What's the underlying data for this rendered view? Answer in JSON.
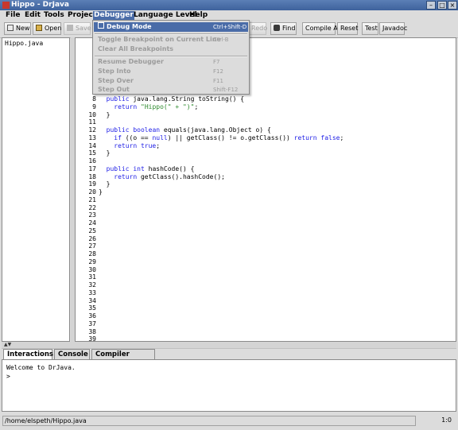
{
  "window": {
    "title": "Hippo - DrJava",
    "buttons": [
      "minimize-icon",
      "maximize-icon",
      "close-icon"
    ]
  },
  "menu": [
    {
      "label": "File"
    },
    {
      "label": "Edit"
    },
    {
      "label": "Tools"
    },
    {
      "label": "Project"
    },
    {
      "label": "Debugger"
    },
    {
      "label": "Language Level"
    },
    {
      "label": "Help"
    }
  ],
  "toolbar": {
    "new": "New",
    "open": "Open",
    "save": "Save",
    "redo": "Redo",
    "find": "Find",
    "compile_all": "Compile All",
    "reset": "Reset",
    "test": "Test",
    "javadoc": "Javadoc"
  },
  "files": [
    "Hippo.java"
  ],
  "editor": {
    "code_lines": [
      {
        "n": "8",
        "parts": [
          [
            "pl",
            "  "
          ],
          [
            "kw",
            "public"
          ],
          [
            "pl",
            " java.lang.String toString() {"
          ]
        ]
      },
      {
        "n": "9",
        "parts": [
          [
            "pl",
            "    "
          ],
          [
            "kw",
            "return"
          ],
          [
            "pl",
            " "
          ],
          [
            "str",
            "\"Hippo(\" + \")\""
          ],
          [
            "pl",
            ";"
          ]
        ]
      },
      {
        "n": "10",
        "parts": [
          [
            "pl",
            "  }"
          ]
        ]
      },
      {
        "n": "11",
        "parts": [
          [
            "pl",
            ""
          ]
        ]
      },
      {
        "n": "12",
        "parts": [
          [
            "pl",
            "  "
          ],
          [
            "kw",
            "public boolean"
          ],
          [
            "pl",
            " equals(java.lang.Object o) {"
          ]
        ]
      },
      {
        "n": "13",
        "parts": [
          [
            "pl",
            "    "
          ],
          [
            "kw",
            "if"
          ],
          [
            "pl",
            " ((o == "
          ],
          [
            "kw",
            "null"
          ],
          [
            "pl",
            ") || getClass() != o.getClass()) "
          ],
          [
            "kw",
            "return false"
          ],
          [
            "pl",
            ";"
          ]
        ]
      },
      {
        "n": "14",
        "parts": [
          [
            "pl",
            "    "
          ],
          [
            "kw",
            "return true"
          ],
          [
            "pl",
            ";"
          ]
        ]
      },
      {
        "n": "15",
        "parts": [
          [
            "pl",
            "  }"
          ]
        ]
      },
      {
        "n": "16",
        "parts": [
          [
            "pl",
            ""
          ]
        ]
      },
      {
        "n": "17",
        "parts": [
          [
            "pl",
            "  "
          ],
          [
            "kw",
            "public int"
          ],
          [
            "pl",
            " hashCode() {"
          ]
        ]
      },
      {
        "n": "18",
        "parts": [
          [
            "pl",
            "    "
          ],
          [
            "kw",
            "return"
          ],
          [
            "pl",
            " getClass().hashCode();"
          ]
        ]
      },
      {
        "n": "19",
        "parts": [
          [
            "pl",
            "  }"
          ]
        ]
      },
      {
        "n": "20",
        "parts": [
          [
            "pl",
            "}"
          ]
        ]
      }
    ],
    "empty_lines": [
      "21",
      "22",
      "23",
      "24",
      "25",
      "26",
      "27",
      "28",
      "29",
      "30",
      "31",
      "32",
      "33",
      "34",
      "35",
      "36",
      "37",
      "38",
      "39"
    ]
  },
  "bottom_tabs": [
    "Interactions",
    "Console",
    "Compiler Output"
  ],
  "console": {
    "welcome": "Welcome to DrJava.",
    "prompt": ">"
  },
  "status": {
    "path": "/home/elspeth/Hippo.java",
    "position": "1:0"
  },
  "debugger_menu": [
    {
      "label": "Debug Mode",
      "shortcut": "Ctrl+Shift-D",
      "state": "highlight"
    },
    {
      "label": "Toggle Breakpoint on Current Line",
      "shortcut": "Ctrl-B",
      "state": "disabled"
    },
    {
      "label": "Clear All Breakpoints",
      "shortcut": "",
      "state": "disabled"
    },
    {
      "label": "Resume Debugger",
      "shortcut": "F7",
      "state": "disabled"
    },
    {
      "label": "Step Into",
      "shortcut": "F12",
      "state": "disabled"
    },
    {
      "label": "Step Over",
      "shortcut": "F11",
      "state": "disabled"
    },
    {
      "label": "Step Out",
      "shortcut": "Shift-F12",
      "state": "disabled"
    }
  ],
  "colors": {
    "keyword": "#1d1de6",
    "string": "#2c8a2c",
    "highlight": "#4a6ca8"
  }
}
